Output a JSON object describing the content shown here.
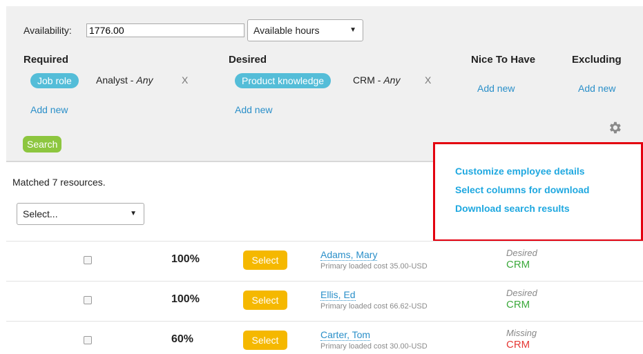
{
  "availability": {
    "label": "Availability:",
    "value": "1776.00",
    "unit_select": "Available hours"
  },
  "criteria": {
    "required": {
      "heading": "Required",
      "chip": "Job role",
      "value": "Analyst",
      "qualifier": "Any",
      "remove": "X",
      "add": "Add new"
    },
    "desired": {
      "heading": "Desired",
      "chip": "Product knowledge",
      "value": "CRM",
      "qualifier": "Any",
      "remove": "X",
      "add": "Add new"
    },
    "nice": {
      "heading": "Nice To Have",
      "add": "Add new"
    },
    "excluding": {
      "heading": "Excluding",
      "add": "Add new"
    }
  },
  "search_button": "Search",
  "gear_icon": "gear-icon",
  "results": {
    "matched_text": "Matched 7 resources.",
    "bulk_select": "Select..."
  },
  "menu": {
    "items": [
      "Customize employee details",
      "Select columns for download",
      "Download search results"
    ],
    "highlight_color": "#e3000f"
  },
  "rows": [
    {
      "pct": "100%",
      "select": "Select",
      "name": "Adams, Mary",
      "cost": "Primary loaded cost 35.00-USD",
      "status": "Desired",
      "skill": "CRM",
      "skill_color": "#3daa3d"
    },
    {
      "pct": "100%",
      "select": "Select",
      "name": "Ellis, Ed",
      "cost": "Primary loaded cost 66.62-USD",
      "status": "Desired",
      "skill": "CRM",
      "skill_color": "#3daa3d"
    },
    {
      "pct": "60%",
      "select": "Select",
      "name": "Carter, Tom",
      "cost": "Primary loaded cost 30.00-USD",
      "status": "Missing",
      "skill": "CRM",
      "skill_color": "#e53935"
    }
  ]
}
